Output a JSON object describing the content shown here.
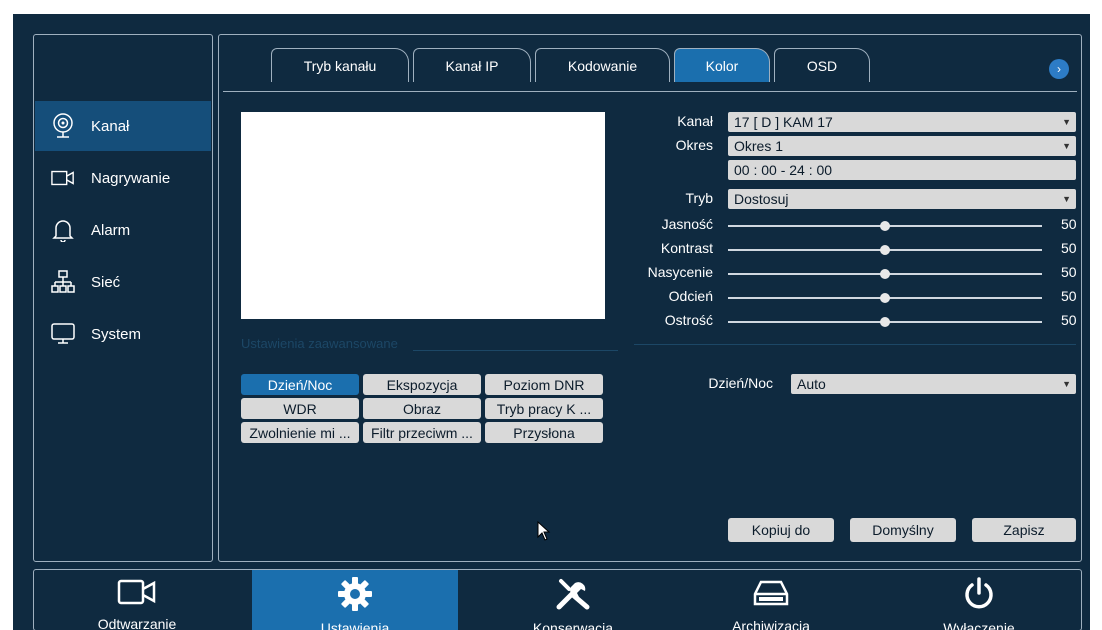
{
  "sidebar": {
    "items": [
      {
        "label": "Kanał",
        "icon": "camera-lens-icon",
        "active": true
      },
      {
        "label": "Nagrywanie",
        "icon": "video-camera-icon",
        "active": false
      },
      {
        "label": "Alarm",
        "icon": "bell-icon",
        "active": false
      },
      {
        "label": "Sieć",
        "icon": "network-icon",
        "active": false
      },
      {
        "label": "System",
        "icon": "monitor-icon",
        "active": false
      }
    ]
  },
  "tabs": [
    {
      "label": "Tryb kanału",
      "active": false
    },
    {
      "label": "Kanał IP",
      "active": false
    },
    {
      "label": "Kodowanie",
      "active": false
    },
    {
      "label": "Kolor",
      "active": true
    },
    {
      "label": "OSD",
      "active": false
    }
  ],
  "tab_next_glyph": "›",
  "form": {
    "kanal_label": "Kanał",
    "kanal_value": "17 [ D ] KAM 17",
    "okres_label": "Okres",
    "okres_value": "Okres 1",
    "time_range": "00  : 00   -  24  : 00",
    "tryb_label": "Tryb",
    "tryb_value": "Dostosuj",
    "sliders": [
      {
        "label": "Jasność",
        "value": 50
      },
      {
        "label": "Kontrast",
        "value": 50
      },
      {
        "label": "Nasycenie",
        "value": 50
      },
      {
        "label": "Odcień",
        "value": 50
      },
      {
        "label": "Ostrość",
        "value": 50
      }
    ]
  },
  "advanced": {
    "title": "Ustawienia zaawansowane",
    "buttons": [
      {
        "label": "Dzień/Noc",
        "selected": true
      },
      {
        "label": "Ekspozycja",
        "selected": false
      },
      {
        "label": "Poziom DNR",
        "selected": false
      },
      {
        "label": "WDR",
        "selected": false
      },
      {
        "label": "Obraz",
        "selected": false
      },
      {
        "label": "Tryb pracy K ...",
        "selected": false
      },
      {
        "label": "Zwolnienie mi ...",
        "selected": false
      },
      {
        "label": "Filtr przeciwm ...",
        "selected": false
      },
      {
        "label": "Przysłona",
        "selected": false
      }
    ],
    "daynight_label": "Dzień/Noc",
    "daynight_value": "Auto"
  },
  "actions": {
    "copy": "Kopiuj do",
    "default": "Domyślny",
    "save": "Zapisz"
  },
  "bottom": {
    "items": [
      {
        "label": "Odtwarzanie",
        "icon": "video-camera-icon",
        "active": false
      },
      {
        "label": "Ustawienia",
        "icon": "gear-icon",
        "active": true
      },
      {
        "label": "Konserwacja",
        "icon": "tools-icon",
        "active": false
      },
      {
        "label": "Archiwizacja",
        "icon": "drive-icon",
        "active": false
      },
      {
        "label": "Wyłączenie",
        "icon": "power-icon",
        "active": false
      }
    ]
  },
  "colors": {
    "background": "#0f2a40",
    "accent": "#1b6fae",
    "sidebar_active": "#154e7a",
    "field": "#d9d9d9"
  }
}
